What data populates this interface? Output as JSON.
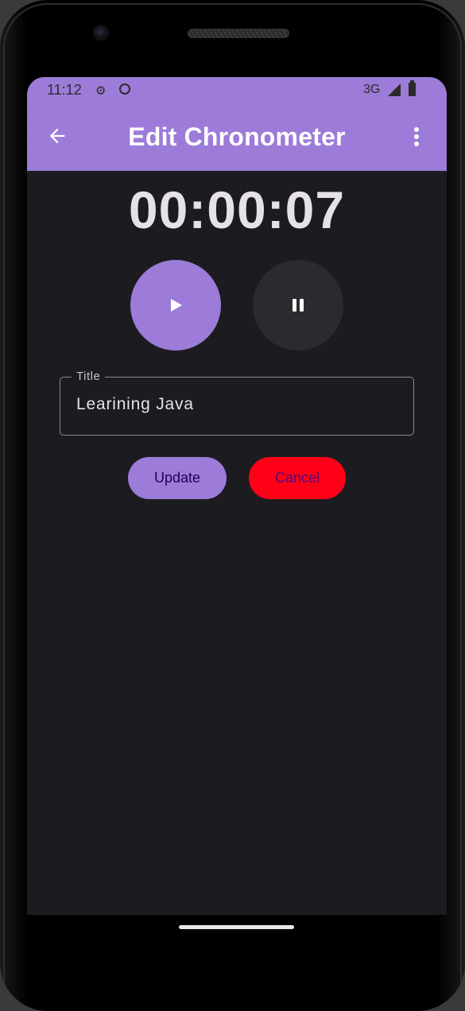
{
  "status_bar": {
    "time": "11:12",
    "network": "3G",
    "icons": [
      "settings-gear-icon",
      "face-icon",
      "cell-signal-icon",
      "battery-icon"
    ]
  },
  "app_bar": {
    "title": "Edit Chronometer",
    "back_icon": "arrow-left-icon",
    "menu_icon": "more-vertical-icon"
  },
  "timer": {
    "display": "00:00:07"
  },
  "controls": {
    "play_icon": "play-icon",
    "pause_icon": "pause-icon"
  },
  "title_field": {
    "label": "Title",
    "value": "Learining Java"
  },
  "actions": {
    "update_label": "Update",
    "cancel_label": "Cancel"
  },
  "colors": {
    "accent": "#9c7bd9",
    "background": "#1c1b1f",
    "cancel": "#ff0019",
    "pause_button": "#2c2a2e"
  }
}
